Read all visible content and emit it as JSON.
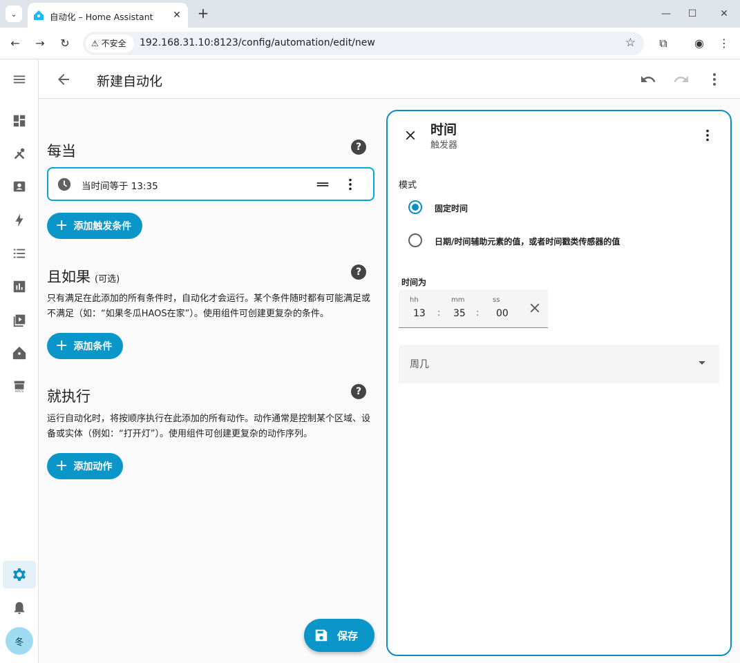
{
  "browser": {
    "tab_title": "自动化 – Home Assistant",
    "security_label": "不安全",
    "url": "192.168.31.10:8123/config/automation/edit/new"
  },
  "header": {
    "title": "新建自动化"
  },
  "sidebar": {
    "avatar_initial": "冬",
    "items": [
      "dashboard-icon",
      "tools-icon",
      "person-card-icon",
      "energy-icon",
      "list-icon",
      "chart-icon",
      "media-icon",
      "home-assistant-icon",
      "hacs-icon",
      "settings-icon",
      "bell-icon"
    ]
  },
  "triggers": {
    "title": "每当",
    "items": [
      {
        "label": "当时间等于 13:35"
      }
    ],
    "add_button": "添加触发条件"
  },
  "conditions": {
    "title": "且如果",
    "optional": "(可选)",
    "description": "只有满足在此添加的所有条件时，自动化才会运行。某个条件随时都有可能满足或不满足（如：“如果冬瓜HAOS在家”）。使用组件可创建更复杂的条件。",
    "add_button": "添加条件"
  },
  "actions": {
    "title": "就执行",
    "description": "运行自动化时，将按顺序执行在此添加的所有动作。动作通常是控制某个区域、设备或实体（例如：“打开灯”）。使用组件可创建更复杂的动作序列。",
    "add_button": "添加动作"
  },
  "save_label": "保存",
  "panel": {
    "title": "时间",
    "subtitle": "触发器",
    "mode_label": "模式",
    "mode_options": [
      "固定时间",
      "日期/时间辅助元素的值，或者时间戳类传感器的值"
    ],
    "mode_selected": "固定时间",
    "time_label": "时间为",
    "time_units": {
      "h": "hh",
      "m": "mm",
      "s": "ss"
    },
    "time_values": {
      "h": "13",
      "m": "35",
      "s": "00"
    },
    "time_sep": ":",
    "weekday_label": "周几"
  },
  "colors": {
    "accent": "#0a8ec2",
    "button": "#0b96c9"
  }
}
